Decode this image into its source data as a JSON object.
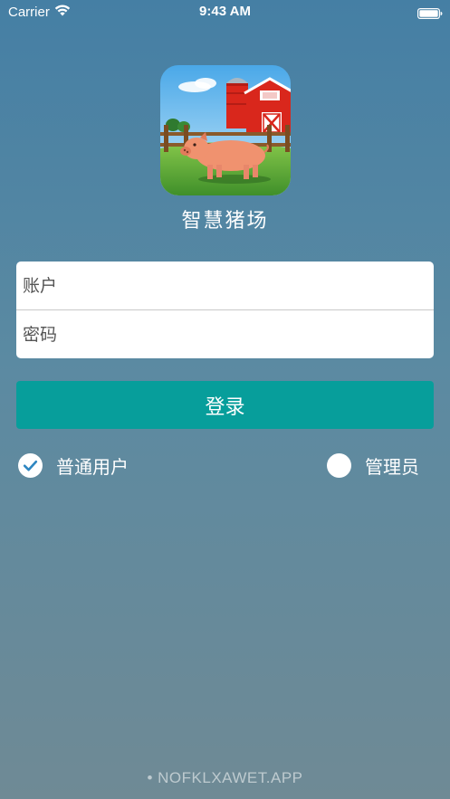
{
  "status_bar": {
    "carrier": "Carrier",
    "time": "9:43 AM",
    "icons": [
      "wifi-icon",
      "battery-icon"
    ]
  },
  "app": {
    "title": "智慧猪场",
    "logo": "farm-pig-logo"
  },
  "form": {
    "account_placeholder": "账户",
    "password_placeholder": "密码",
    "account_value": "",
    "password_value": ""
  },
  "login_button": {
    "label": "登录"
  },
  "roles": [
    {
      "label": "普通用户",
      "selected": true,
      "icon": "checkmark-icon"
    },
    {
      "label": "管理员",
      "selected": false,
      "icon": "radio-empty-icon"
    }
  ],
  "watermark": "• NOFKLXAWET.APP",
  "colors": {
    "background_top": "#457fa4",
    "background_bottom": "#6f8a95",
    "button": "#079e9b",
    "check": "#2e86c1"
  }
}
